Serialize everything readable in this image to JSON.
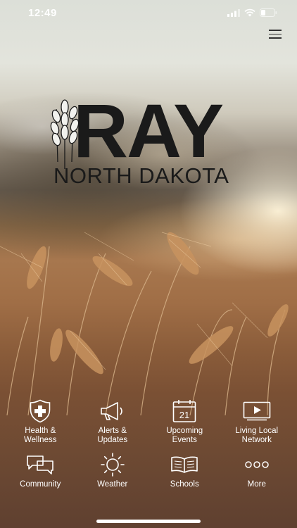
{
  "status_bar": {
    "time": "12:49",
    "icons": [
      "signal-icon",
      "wifi-icon",
      "battery-icon"
    ],
    "battery_level": 0.3
  },
  "header": {
    "menu_icon": "hamburger-menu-icon"
  },
  "logo": {
    "wordmark": "RAY",
    "subtitle": "NORTH DAKOTA",
    "emblem": "wheat-emblem"
  },
  "nav": {
    "row1": [
      {
        "label": "Health &\nWellness",
        "icon": "health-shield-icon"
      },
      {
        "label": "Alerts &\nUpdates",
        "icon": "megaphone-icon"
      },
      {
        "label": "Upcoming\nEvents",
        "icon": "calendar-icon",
        "icon_text": "21"
      },
      {
        "label": "Living Local\nNetwork",
        "icon": "video-play-icon"
      }
    ],
    "row2": [
      {
        "label": "Community",
        "icon": "chat-bubbles-icon"
      },
      {
        "label": "Weather",
        "icon": "sun-icon"
      },
      {
        "label": "Schools",
        "icon": "open-book-icon"
      },
      {
        "label": "More",
        "icon": "more-dots-icon"
      }
    ]
  },
  "colors": {
    "icon_tint": "#ffffff",
    "logo_ink": "#1a1a1a"
  }
}
